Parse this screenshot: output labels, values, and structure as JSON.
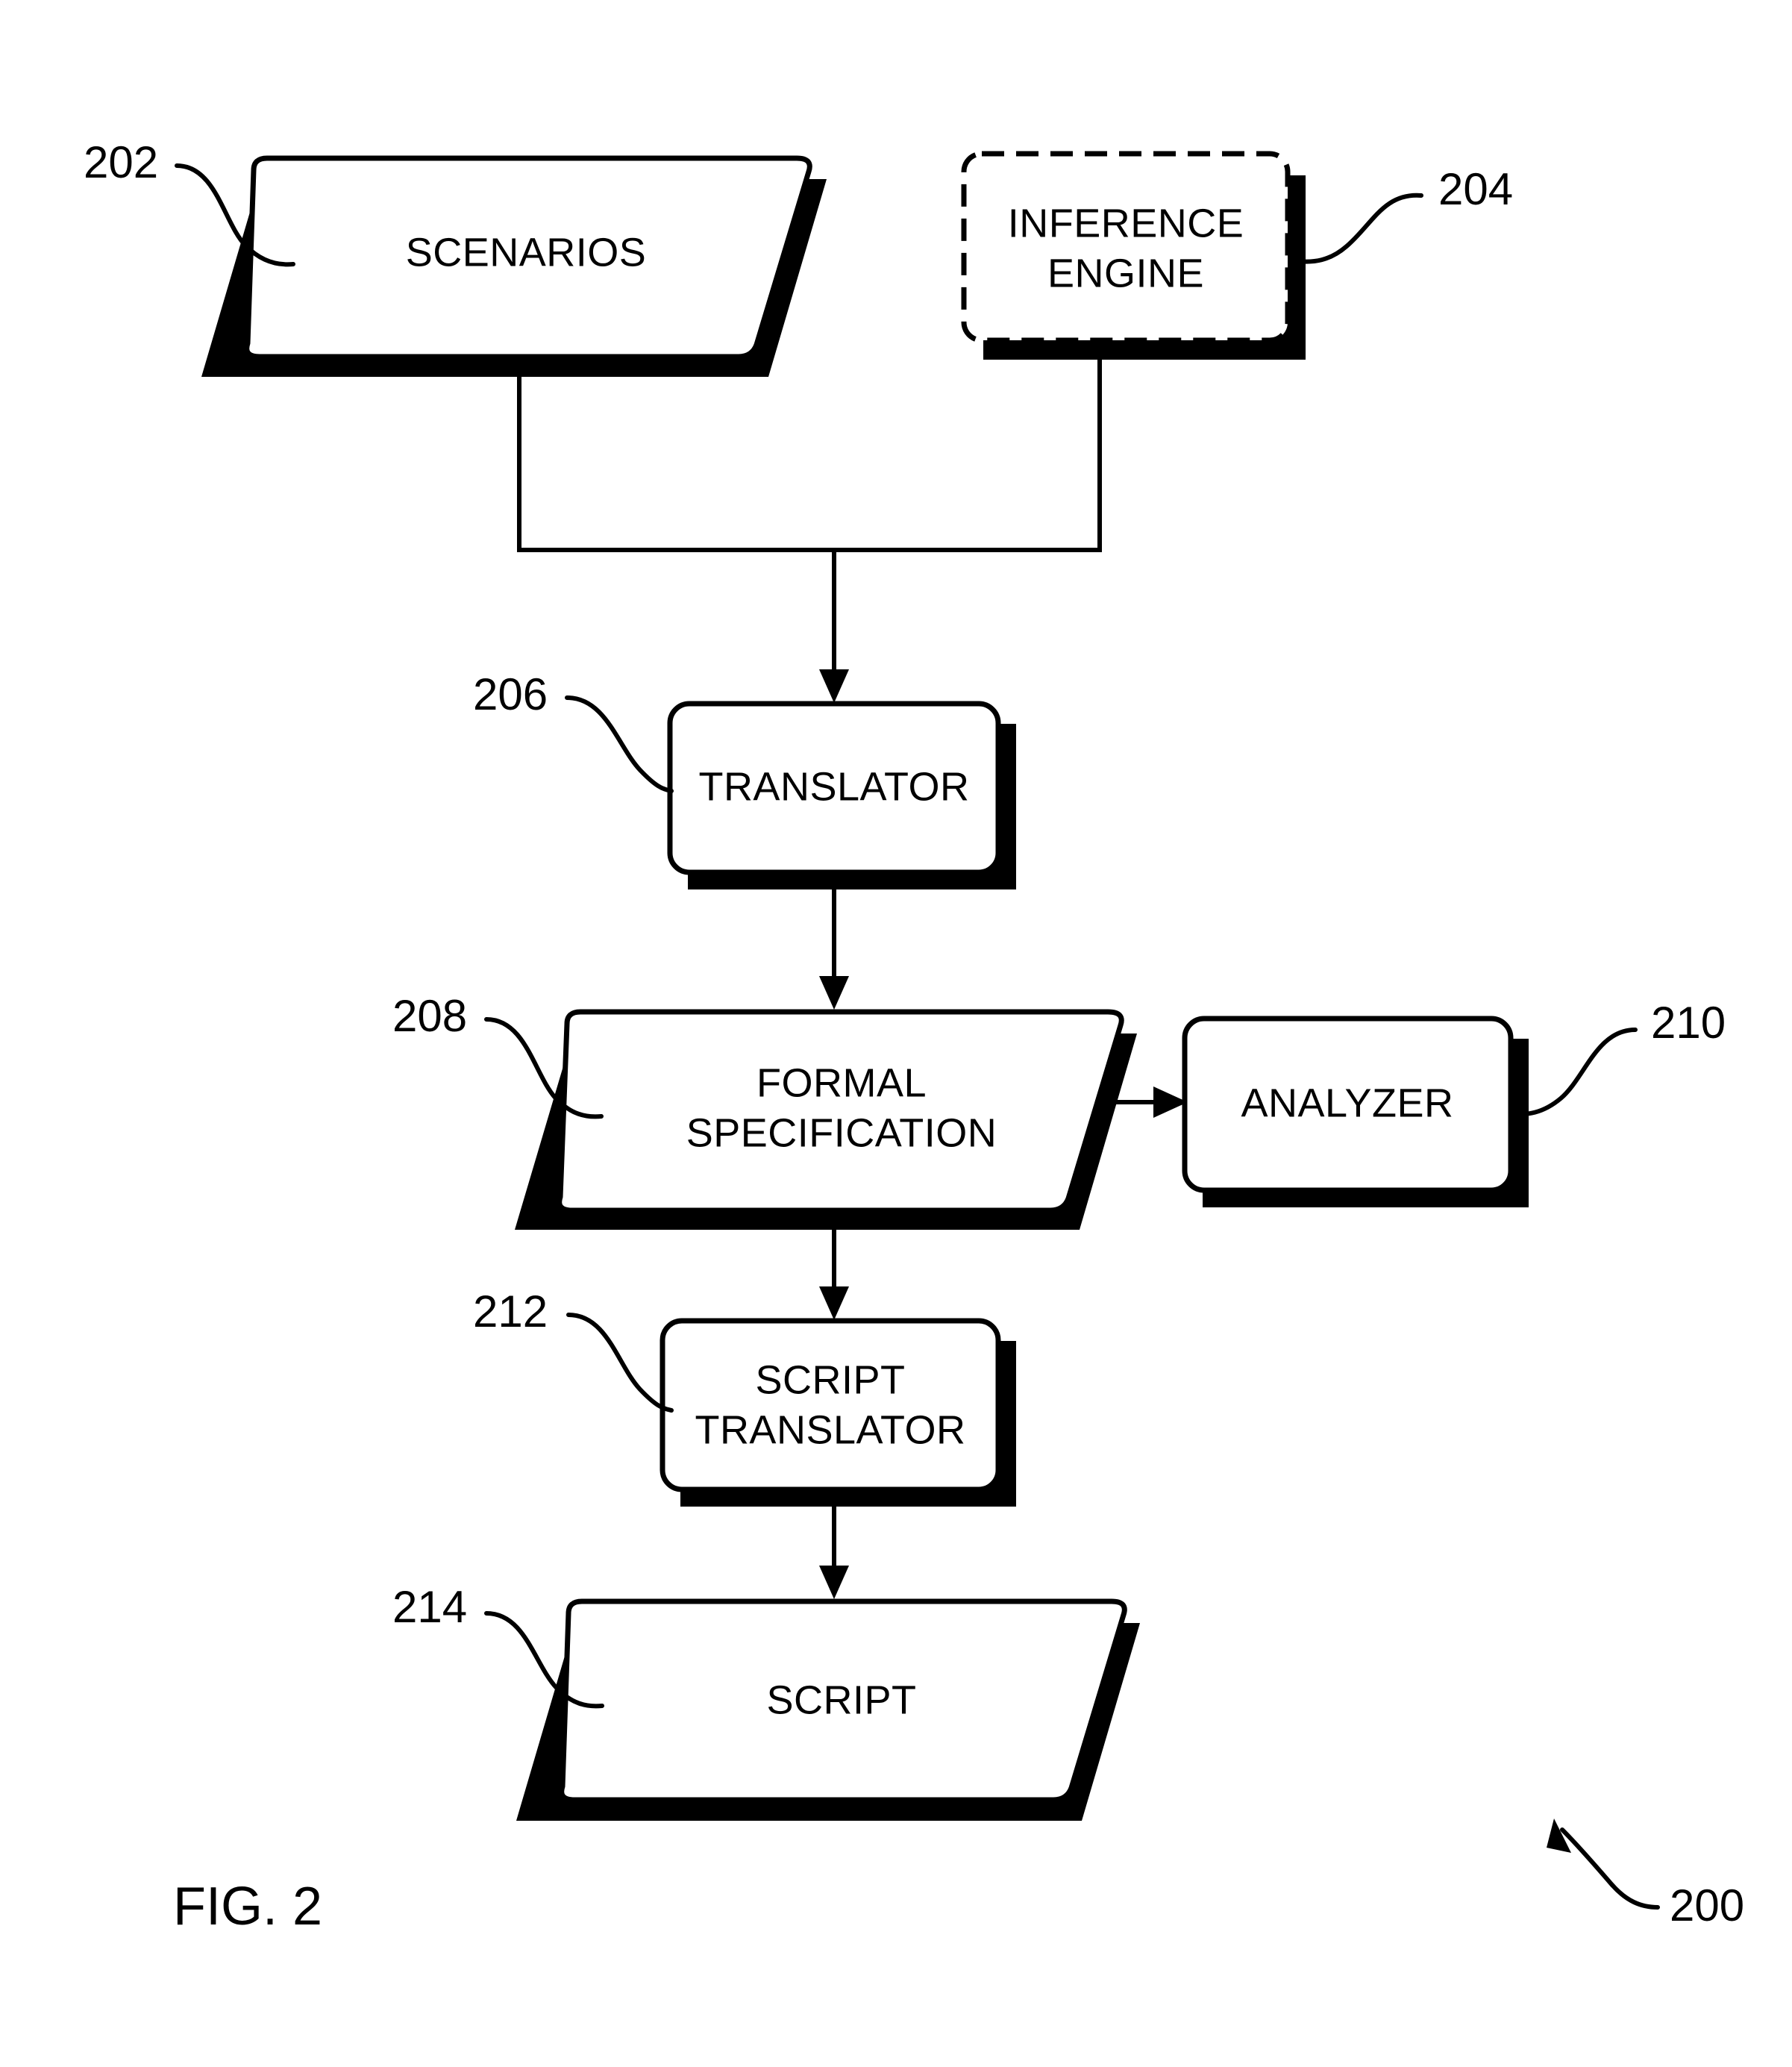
{
  "figure": {
    "caption": "FIG. 2",
    "overall_ref": "200"
  },
  "nodes": [
    {
      "id": "scenarios",
      "label": "SCENARIOS",
      "ref": "202",
      "shape": "parallelogram",
      "border": "solid"
    },
    {
      "id": "inference-engine",
      "label_line1": "INFERENCE",
      "label_line2": "ENGINE",
      "ref": "204",
      "shape": "rounded-rect",
      "border": "dashed"
    },
    {
      "id": "translator",
      "label": "TRANSLATOR",
      "ref": "206",
      "shape": "rounded-rect",
      "border": "solid"
    },
    {
      "id": "formal-specification",
      "label_line1": "FORMAL",
      "label_line2": "SPECIFICATION",
      "ref": "208",
      "shape": "parallelogram",
      "border": "solid"
    },
    {
      "id": "analyzer",
      "label": "ANALYZER",
      "ref": "210",
      "shape": "rounded-rect",
      "border": "solid"
    },
    {
      "id": "script-translator",
      "label_line1": "SCRIPT",
      "label_line2": "TRANSLATOR",
      "ref": "212",
      "shape": "rounded-rect",
      "border": "solid"
    },
    {
      "id": "script",
      "label": "SCRIPT",
      "ref": "214",
      "shape": "parallelogram",
      "border": "solid"
    }
  ],
  "edges": [
    {
      "from": "scenarios",
      "to": "translator",
      "style": "merge-down-arrow"
    },
    {
      "from": "inference-engine",
      "to": "translator",
      "style": "merge-down-arrow"
    },
    {
      "from": "translator",
      "to": "formal-specification",
      "style": "down-arrow"
    },
    {
      "from": "formal-specification",
      "to": "analyzer",
      "style": "right-arrow"
    },
    {
      "from": "formal-specification",
      "to": "script-translator",
      "style": "down-arrow"
    },
    {
      "from": "script-translator",
      "to": "script",
      "style": "down-arrow"
    }
  ],
  "colors": {
    "ink": "#000000",
    "paper": "#ffffff"
  }
}
